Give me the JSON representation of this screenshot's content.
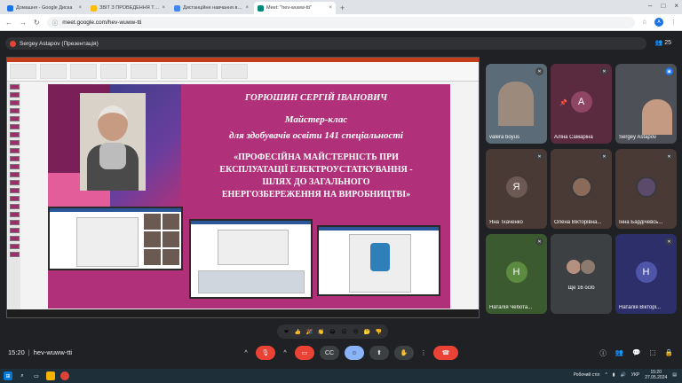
{
  "browser": {
    "tabs": [
      {
        "title": "Домашня - Google Диска",
        "fav_color": "#1a73e8"
      },
      {
        "title": "ЗВІТ З ПРОВЕДЕННЯ ТИЖНЯ...",
        "fav_color": "#fbbc04"
      },
      {
        "title": "Дистанційне навчання в ВСП...",
        "fav_color": "#4285f4"
      },
      {
        "title": "Meet: \"hev-wuww-tti\"",
        "fav_color": "#00897b"
      }
    ],
    "url": "meet.google.com/hev-wuww-tti",
    "profile_initial": "A"
  },
  "meet": {
    "presenter_label": "Sergey Astapov (Презентація)",
    "participant_count": "25",
    "time": "15:20",
    "meeting_code": "hev-wuww-tti"
  },
  "slide": {
    "author": "ГОРЮШИН СЕРГІЙ ІВАНОВИЧ",
    "line1": "Майстер-клас",
    "line2": "для здобувачів освіти 141 спеціальності",
    "title_lines": [
      "«ПРОФЕСІЙНА МАЙСТЕРНІСТЬ ПРИ",
      "ЕКСПЛУАТАЦІЇ ЕЛЕКТРОУСТАТКУВАННЯ -",
      "ШЛЯХ ДО ЗАГАЛЬНОГО",
      "ЕНЕРГОЗБЕРЕЖЕННЯ НА ВИРОБНИЦТВІ»"
    ]
  },
  "participants": [
    {
      "name": "valera boyus",
      "type": "video",
      "bg": "#5b6b78"
    },
    {
      "name": "Аліна Самаріна",
      "type": "initial",
      "initial": "А",
      "bg": "#5a2a3e",
      "circle": "#8e4664"
    },
    {
      "name": "Sergey Astapov",
      "type": "video",
      "bg": "#4d5056"
    },
    {
      "name": "Яна Ткаченко",
      "type": "initial",
      "initial": "Я",
      "bg": "#4a3a36",
      "circle": "#6d5954"
    },
    {
      "name": "Олена Вікторівна...",
      "type": "photo",
      "bg": "#4a3a36"
    },
    {
      "name": "Інна Бардічевсь...",
      "type": "photo",
      "bg": "#4a3a36"
    },
    {
      "name": "Наталія Чебота...",
      "type": "initial",
      "initial": "Н",
      "bg": "#3b5a2f",
      "circle": "#5c8a3e"
    },
    {
      "name": "Ще 16 осіб",
      "type": "more",
      "bg": "#3c4043"
    },
    {
      "name": "Наталія Вікторі...",
      "type": "initial",
      "initial": "Н",
      "bg": "#2c2f6a",
      "circle": "#4f55a8"
    }
  ],
  "taskbar": {
    "tray_label": "Робочий стіл",
    "lang": "УКР",
    "clock_time": "15:20",
    "clock_date": "27.05.2024"
  },
  "colors": {
    "slide_bg": "#b0317a",
    "end_call": "#ea4335",
    "meet_bg": "#202124"
  }
}
